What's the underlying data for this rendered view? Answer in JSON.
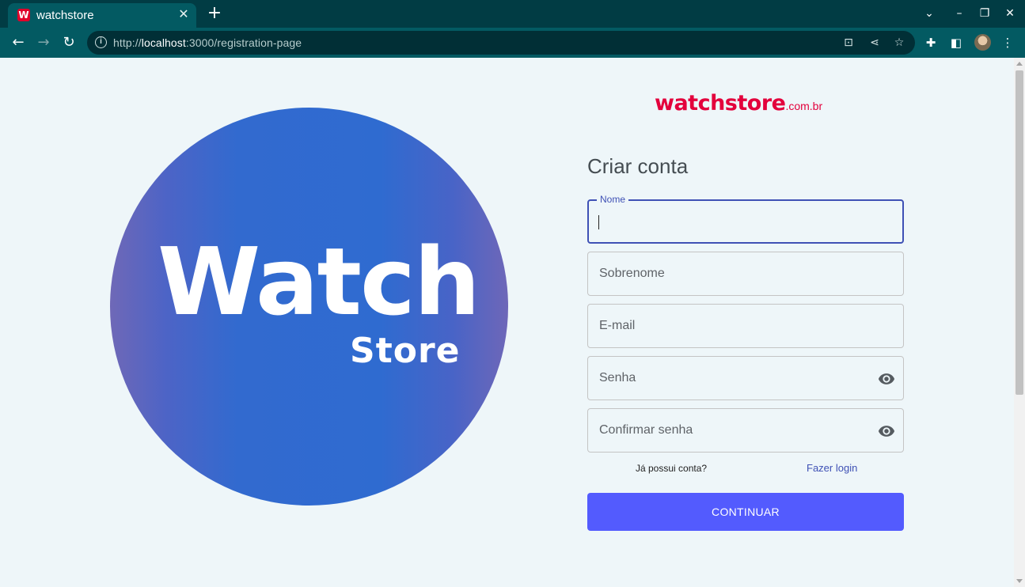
{
  "browser": {
    "tab_title": "watchstore",
    "tab_favicon_letter": "W",
    "url_prefix": "http://",
    "url_host": "localhost",
    "url_rest": ":3000/registration-page"
  },
  "hero": {
    "logo_word_1": "Watch",
    "logo_word_2": "Store",
    "colors": {
      "gradient_center": "#2f6bd0",
      "gradient_edge": "#6f68b7"
    }
  },
  "brand": {
    "name": "watchstore",
    "tld": ".com.br",
    "color": "#e3003c"
  },
  "form": {
    "title": "Criar conta",
    "fields": {
      "first_name": {
        "label": "Nome",
        "value": ""
      },
      "last_name": {
        "placeholder": "Sobrenome"
      },
      "email": {
        "placeholder": "E-mail"
      },
      "password": {
        "placeholder": "Senha"
      },
      "confirm_password": {
        "placeholder": "Confirmar senha"
      }
    },
    "have_account_text": "Já possui conta?",
    "login_link": "Fazer login",
    "submit_label": "CONTINUAR",
    "colors": {
      "accent": "#3f51b5",
      "button": "#535bfe"
    }
  }
}
